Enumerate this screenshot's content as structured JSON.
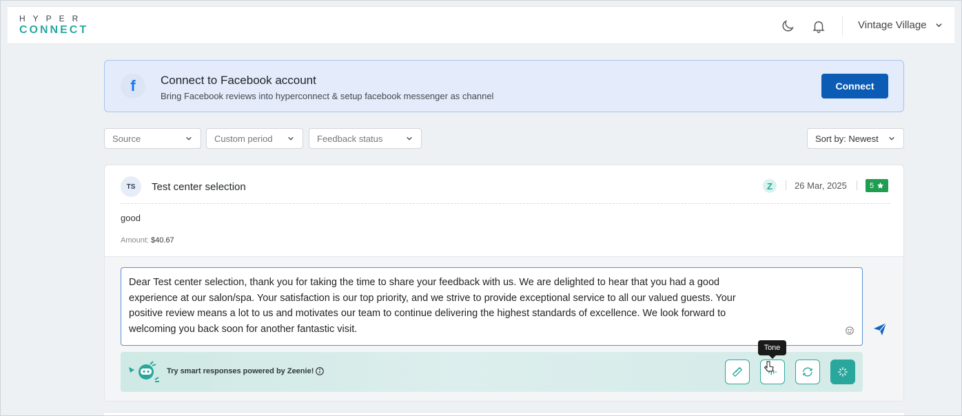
{
  "header": {
    "logo_top": "HYPER",
    "logo_bottom": "CONNECT",
    "account_name": "Vintage Village",
    "icons": [
      "moon-icon",
      "bell-icon",
      "chevron-down-icon"
    ]
  },
  "banner": {
    "title": "Connect to Facebook account",
    "subtitle": "Bring Facebook reviews into hyperconnect & setup facebook messenger as channel",
    "connect_label": "Connect",
    "icon": "facebook-icon"
  },
  "filters": {
    "source": "Source",
    "period": "Custom period",
    "status": "Feedback status",
    "sort": "Sort by: Newest"
  },
  "review": {
    "initials": "TS",
    "reviewer": "Test center selection",
    "source_badge": "Z",
    "date": "26 Mar, 2025",
    "rating": "5",
    "text": "good",
    "amount_label": "Amount:",
    "amount_value": "$40.67"
  },
  "reply": {
    "text": "Dear Test center selection, thank you for taking the time to share your feedback with us. We are delighted to hear that you had a good experience at our salon/spa. Your satisfaction is our top priority, and we strive to provide exceptional service to all our valued guests. Your positive review means a lot to us and motivates our team to continue delivering the highest standards of excellence. We look forward to welcoming you back soon for another fantastic visit.",
    "line1": "Dear Test center selection, thank you for taking the time to share your feedback with us. We are delighted to hear that you had a good",
    "line2": "experience at our salon/spa. Your satisfaction is our top priority, and we strive to provide exceptional service to all our valued guests. Your",
    "line3": "positive review means a lot to us and motivates our team to continue delivering the highest standards of excellence. We look forward to",
    "line4": "welcoming you back soon for another fantastic visit."
  },
  "zeenie": {
    "prompt": "Try smart responses powered by Zeenie!",
    "tooltip": "Tone",
    "tools": [
      "ruler-icon",
      "tone-icon",
      "refresh-icon",
      "sparkle-icon"
    ]
  },
  "colors": {
    "primary": "#0c5bb4",
    "teal": "#2aa79c",
    "rating_green": "#1f9d50",
    "banner_bg": "#e4ecfb"
  }
}
